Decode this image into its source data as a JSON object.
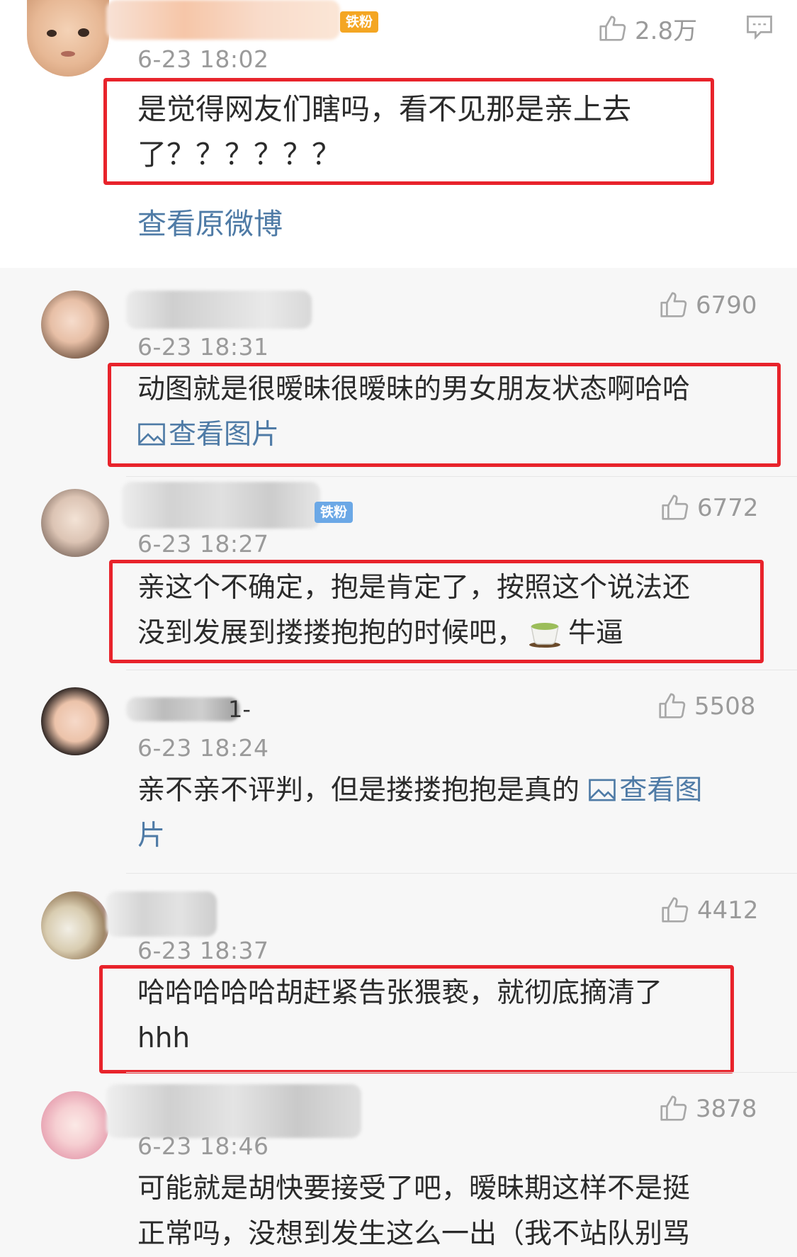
{
  "top_comment": {
    "badge": "铁粉",
    "likes": "2.8万",
    "time": "6-23 18:02",
    "text_line1": "是觉得网友们瞎吗，看不见那是亲上去",
    "text_line2": "了？？？？？？",
    "view_original": "查看原微博"
  },
  "replies": [
    {
      "likes": "6790",
      "time": "6-23 18:31",
      "text_line1": "动图就是很暧昧很暧昧的男女朋友状态啊哈哈",
      "link": "查看图片"
    },
    {
      "badge": "铁粉",
      "likes": "6772",
      "time": "6-23 18:27",
      "text_line1": "亲这个不确定，抱是肯定了，按照这个说法还",
      "text_line2a": "没到发展到搂搂抱抱的时候吧，",
      "text_line2b": "牛逼"
    },
    {
      "name_tail": "1-",
      "likes": "5508",
      "time": "6-23 18:24",
      "text_line1": "亲不亲不评判，但是搂搂抱抱是真的",
      "link_line1": "查看图",
      "link_line2": "片"
    },
    {
      "likes": "4412",
      "time": "6-23 18:37",
      "text_line1": "哈哈哈哈哈胡赶紧告张猥亵，就彻底摘清了",
      "text_line2": "hhh"
    },
    {
      "likes": "3878",
      "time": "6-23 18:46",
      "text_line1": "可能就是胡快要接受了吧，暧昧期这样不是挺",
      "text_line2": "正常吗，没想到发生这么一出（我不站队别骂"
    }
  ],
  "colors": {
    "highlight_box": "#e8232b",
    "link": "#4f7ba6",
    "meta_text": "#9a9a9a",
    "badge_orange": "#f4a623",
    "badge_blue": "#6ba8e6"
  }
}
